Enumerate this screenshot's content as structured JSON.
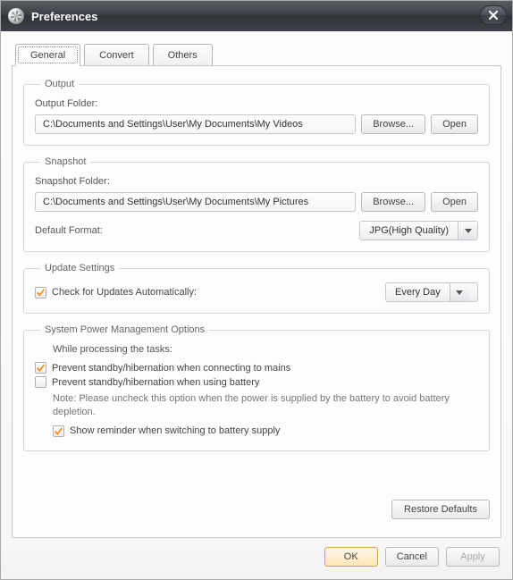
{
  "window": {
    "title": "Preferences"
  },
  "tabs": {
    "general": "General",
    "convert": "Convert",
    "others": "Others"
  },
  "output": {
    "legend": "Output",
    "folder_label": "Output Folder:",
    "folder_path": "C:\\Documents and Settings\\User\\My Documents\\My Videos",
    "browse": "Browse...",
    "open": "Open"
  },
  "snapshot": {
    "legend": "Snapshot",
    "folder_label": "Snapshot Folder:",
    "folder_path": "C:\\Documents and Settings\\User\\My Documents\\My Pictures",
    "browse": "Browse...",
    "open": "Open",
    "format_label": "Default Format:",
    "format_value": "JPG(High Quality)"
  },
  "update": {
    "legend": "Update Settings",
    "check_label": "Check for Updates Automatically:",
    "check_checked": true,
    "frequency": "Every Day"
  },
  "power": {
    "legend": "System Power Management Options",
    "while_label": "While processing the tasks:",
    "prevent_mains": "Prevent standby/hibernation when connecting to mains",
    "prevent_mains_checked": true,
    "prevent_battery": "Prevent standby/hibernation when using battery",
    "prevent_battery_checked": false,
    "note": "Note: Please uncheck this option when the power is supplied by the battery to avoid battery depletion.",
    "show_reminder": "Show reminder when switching to battery supply",
    "show_reminder_checked": true
  },
  "actions": {
    "restore": "Restore Defaults",
    "ok": "OK",
    "cancel": "Cancel",
    "apply": "Apply"
  }
}
